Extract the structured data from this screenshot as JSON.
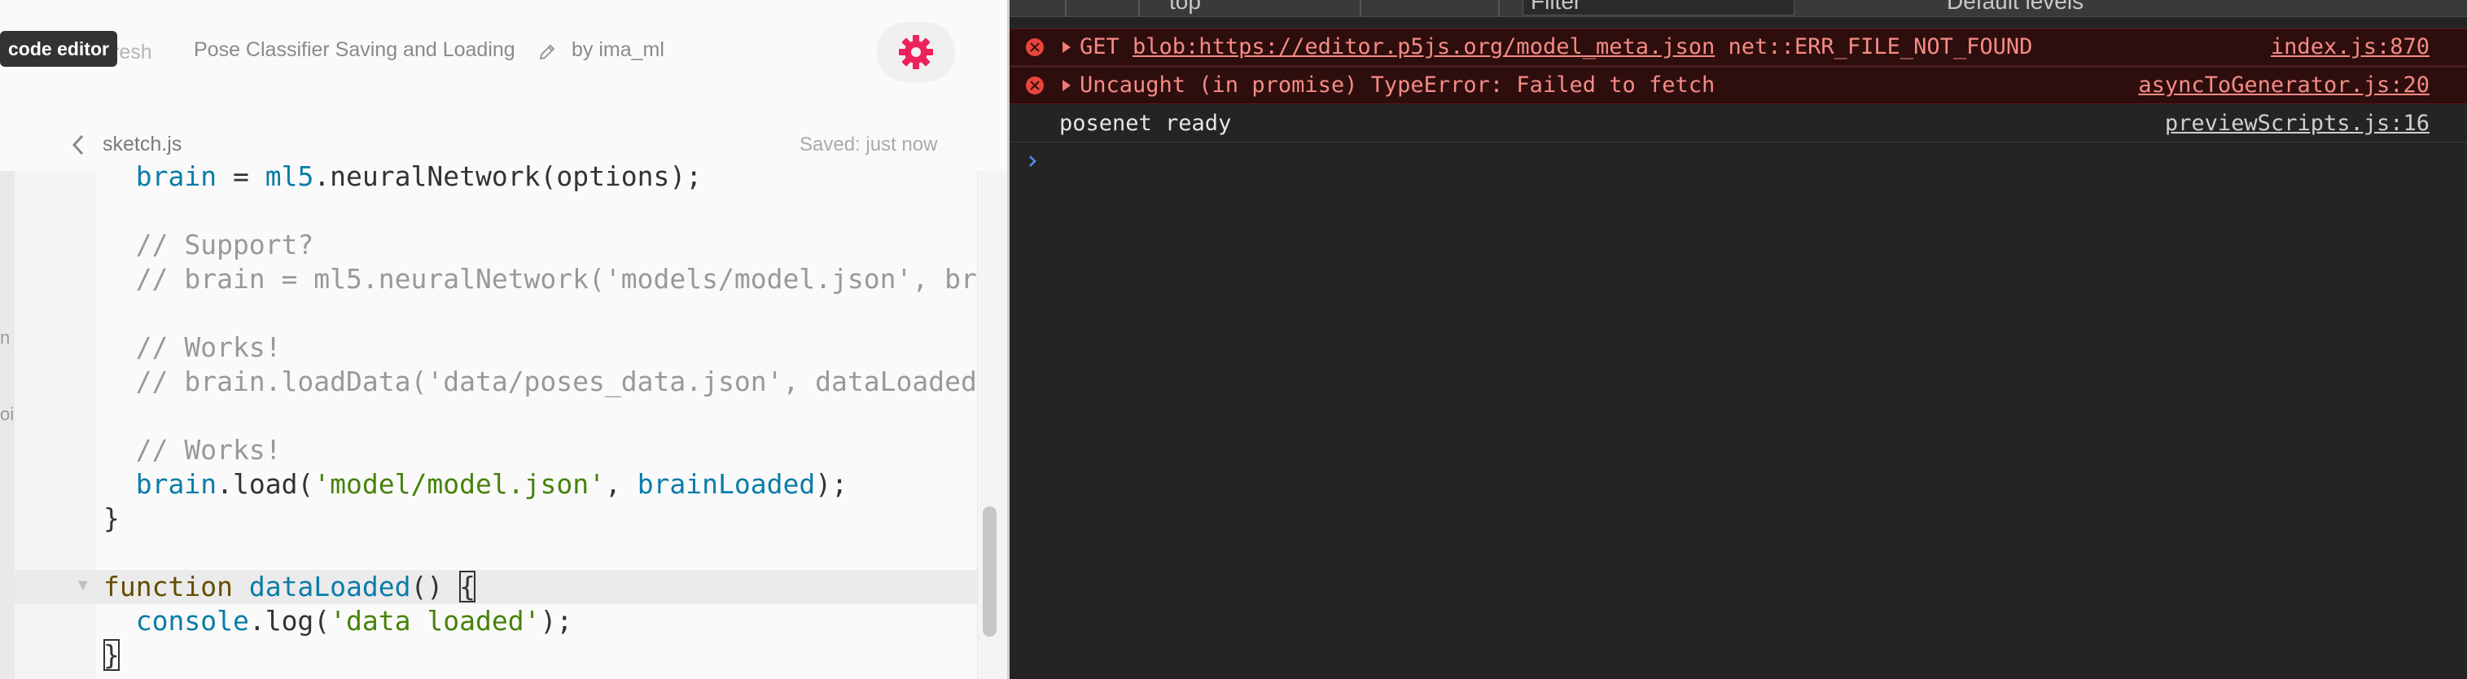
{
  "editor": {
    "tooltip": "code editor",
    "refresh_label": "resh",
    "sketch_title": "Pose Classifier Saving and Loading",
    "author": "by ima_ml",
    "file_tab": "sketch.js",
    "saved_status": "Saved: just now",
    "side_fragments": [
      "n",
      "oi"
    ],
    "code_lines": [
      [
        {
          "t": "  "
        },
        {
          "t": "brain",
          "c": "var"
        },
        {
          "t": " = "
        },
        {
          "t": "ml5",
          "c": "var"
        },
        {
          "t": ".neuralNetwork(options);"
        }
      ],
      [],
      [
        {
          "t": "  // Support?",
          "c": "comment"
        }
      ],
      [
        {
          "t": "  // brain = ml5.neuralNetwork('models/model.json', br",
          "c": "comment"
        }
      ],
      [],
      [
        {
          "t": "  // Works!",
          "c": "comment"
        }
      ],
      [
        {
          "t": "  // brain.loadData('data/poses_data.json', dataLoaded",
          "c": "comment"
        }
      ],
      [],
      [
        {
          "t": "  // Works!",
          "c": "comment"
        }
      ],
      [
        {
          "t": "  "
        },
        {
          "t": "brain",
          "c": "var"
        },
        {
          "t": ".load("
        },
        {
          "t": "'model/model.json'",
          "c": "string"
        },
        {
          "t": ", "
        },
        {
          "t": "brainLoaded",
          "c": "var"
        },
        {
          "t": ");"
        }
      ],
      [
        {
          "t": "}"
        }
      ],
      [],
      [
        {
          "t": "function",
          "c": "keyword"
        },
        {
          "t": " "
        },
        {
          "t": "dataLoaded",
          "c": "var"
        },
        {
          "t": "() "
        },
        {
          "t": "{",
          "c": "bracket"
        }
      ],
      [
        {
          "t": "  "
        },
        {
          "t": "console",
          "c": "var"
        },
        {
          "t": ".log("
        },
        {
          "t": "'data loaded'",
          "c": "string"
        },
        {
          "t": ");"
        }
      ],
      [
        {
          "t": "}",
          "c": "bracket"
        }
      ]
    ]
  },
  "console": {
    "toolbar": {
      "context": "top",
      "filter_placeholder": "Filter",
      "levels": "Default levels"
    },
    "messages": [
      {
        "type": "error",
        "prefix": "GET ",
        "url": "blob:https://editor.p5js.org/model_meta.json",
        "suffix": " net::ERR_FILE_NOT_FOUND",
        "source": "index.js:870"
      },
      {
        "type": "error",
        "prefix": "Uncaught (in promise) TypeError: Failed to fetch",
        "url": "",
        "suffix": "",
        "source": "asyncToGenerator.js:20"
      },
      {
        "type": "log",
        "prefix": "posenet ready",
        "url": "",
        "suffix": "",
        "source": "previewScripts.js:16"
      }
    ]
  },
  "colors": {
    "settings_accent": "#ed225d",
    "error_text": "#f58b84",
    "error_bg": "#2e0d0d",
    "prompt": "#4c8df6"
  }
}
